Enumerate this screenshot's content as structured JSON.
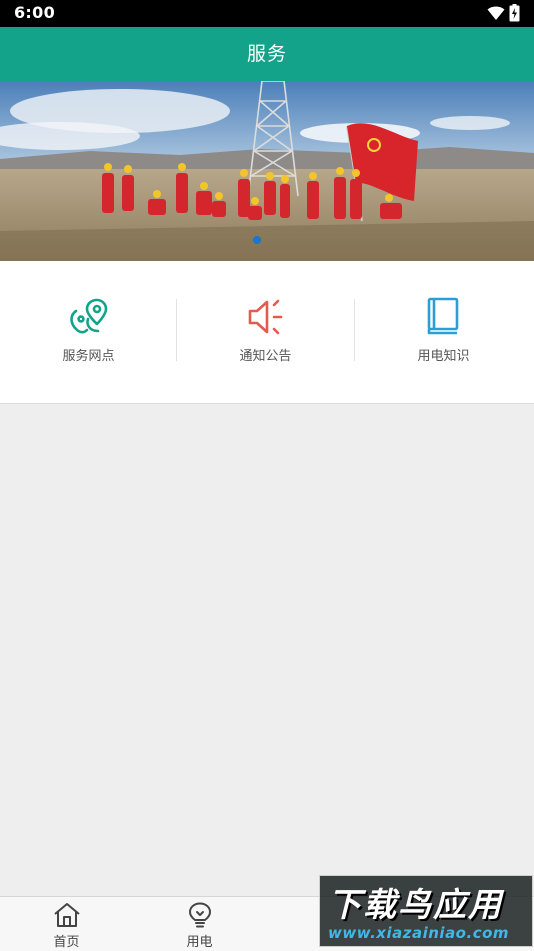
{
  "status_bar": {
    "time": "6:00",
    "icons": [
      "wifi-icon",
      "battery-icon"
    ]
  },
  "header": {
    "title": "服务"
  },
  "banner": {
    "dots_total": 1,
    "active_dot": 0,
    "accent": "#1976d2"
  },
  "quick_links": [
    {
      "label": "服务网点",
      "icon": "location-pin-icon",
      "color": "#13a38a"
    },
    {
      "label": "通知公告",
      "icon": "speaker-icon",
      "color": "#e25b4f"
    },
    {
      "label": "用电知识",
      "icon": "book-icon",
      "color": "#2a9fd6"
    }
  ],
  "bottom_nav": [
    {
      "label": "首页",
      "icon": "home-icon"
    },
    {
      "label": "用电",
      "icon": "lightbulb-icon"
    }
  ],
  "watermark": {
    "title": "下载鸟应用",
    "url": "www.xiazainiao.com"
  },
  "colors": {
    "primary": "#13a38a",
    "background": "#eeeeee"
  }
}
